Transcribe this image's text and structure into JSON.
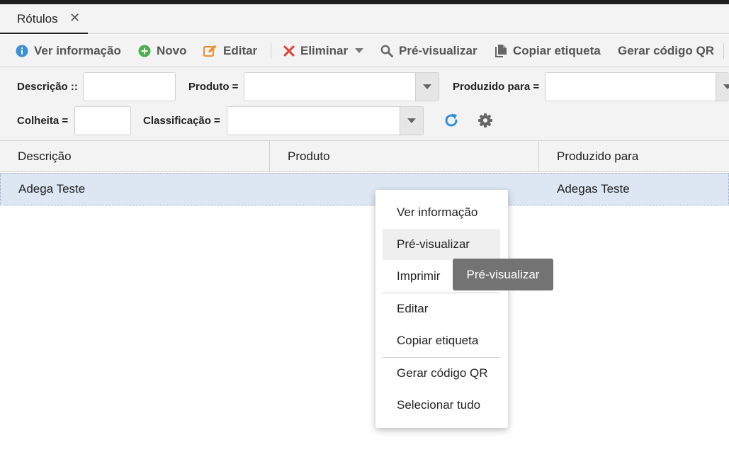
{
  "tab": {
    "label": "Rótulos",
    "close": "✕"
  },
  "toolbar": {
    "view_info": "Ver informação",
    "new": "Novo",
    "edit": "Editar",
    "delete": "Eliminar",
    "preview": "Pré-visualizar",
    "copy_label": "Copiar etiqueta",
    "generate_qr": "Gerar código QR"
  },
  "filters": {
    "description_label": "Descrição ::",
    "description_value": "",
    "product_label": "Produto =",
    "product_value": "",
    "produced_for_label": "Produzido para =",
    "produced_for_value": "",
    "harvest_label": "Colheita =",
    "harvest_value": "",
    "classification_label": "Classificação =",
    "classification_value": ""
  },
  "grid": {
    "columns": [
      "Descrição",
      "Produto",
      "Produzido para"
    ],
    "rows": [
      {
        "descricao": "Adega Teste",
        "produto": "",
        "produzido_para": "Adegas Teste"
      }
    ]
  },
  "context_menu": {
    "items": [
      "Ver informação",
      "Pré-visualizar",
      "Imprimir",
      "Editar",
      "Copiar etiqueta",
      "Gerar código QR",
      "Selecionar tudo"
    ],
    "hovered": "Pré-visualizar"
  },
  "tooltip": {
    "text": "Pré-visualizar"
  },
  "colors": {
    "info_blue": "#3b8fd4",
    "new_green": "#4caf50",
    "edit_orange": "#f08c2b",
    "delete_red": "#e03c31",
    "refresh_blue": "#2f8fd8",
    "row_selected": "#dde7f3"
  },
  "icons": {
    "view_info": "info-circle-icon",
    "new": "plus-circle-icon",
    "edit": "edit-icon",
    "delete": "x-icon",
    "delete_menu": "caret-down-icon",
    "preview": "search-icon",
    "copy_label": "copy-icon",
    "refresh": "refresh-icon",
    "settings": "gear-icon"
  }
}
